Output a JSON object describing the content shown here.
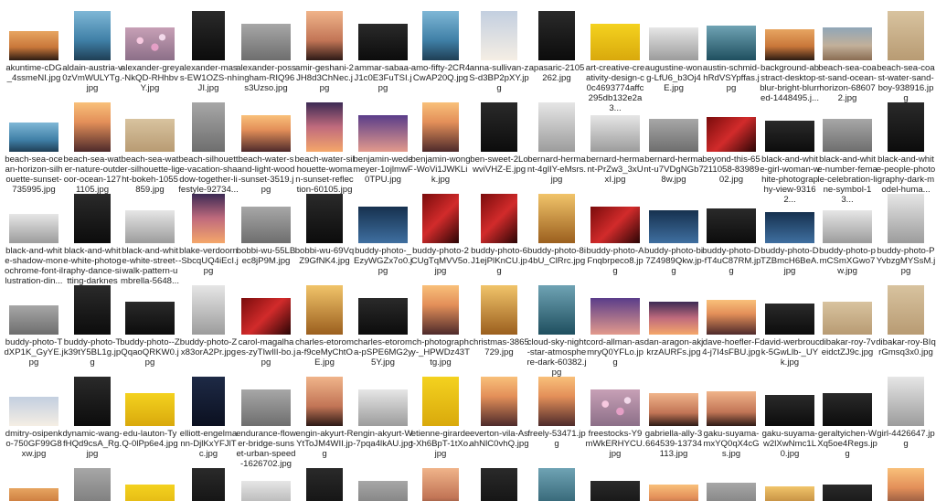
{
  "files": [
    {
      "name": "akuntime-cDG_4ssmeNI.jpg",
      "thumb": "t-sun1"
    },
    {
      "name": "aldain-austria-v0zVmWULYTg.jpg",
      "thumb": "t-lake"
    },
    {
      "name": "alexander-grey-NkQD-RHhbvY.jpg",
      "thumb": "t-bokeh"
    },
    {
      "name": "alexander-mass-EW1OZS-nhJI.jpg",
      "thumb": "t-dark"
    },
    {
      "name": "alexander-possingham-RIQ96s3Uzso.jpg",
      "thumb": "t-grey"
    },
    {
      "name": "amir-geshani-2JH8d3ChNec.jpg",
      "thumb": "t-warm"
    },
    {
      "name": "ammar-sabaa-J1c0E3FuTSI.jpg",
      "thumb": "t-dark"
    },
    {
      "name": "amo-fifty-2CR4CwAP20Q.jpg",
      "thumb": "t-lake"
    },
    {
      "name": "anna-sullivan-zS-d3BP2pXY.jpg",
      "thumb": "t-sky"
    },
    {
      "name": "apasaric-2105262.jpg",
      "thumb": "t-dark"
    },
    {
      "name": "art-creative-creativity-design-c0c4693774affc295db132e2a3...",
      "thumb": "t-yellow"
    },
    {
      "name": "augustine-wong-LfU6_b3Oj4E.jpg",
      "thumb": "t-mono"
    },
    {
      "name": "austin-schmid-hRdVSYpffas.jpg",
      "thumb": "t-teal"
    },
    {
      "name": "background-abstract-desktop-blur-bright-blurred-1448495.j...",
      "thumb": "t-sun1"
    },
    {
      "name": "beach-sea-coast-sand-ocean-horizon-686072.jpg",
      "thumb": "t-beach"
    },
    {
      "name": "beach-sea-coast-water-sand-boy-938916.jpg",
      "thumb": "t-sand"
    },
    {
      "name": "beach-sea-ocean-horizon-silhouette-sunset-735995.jpg",
      "thumb": "t-lake"
    },
    {
      "name": "beach-sea-water-nature-outdoor-ocean-1271105.jpg",
      "thumb": "t-sunset2"
    },
    {
      "name": "beach-sea-water-silhouette-light-bokeh-1055859.jpg",
      "thumb": "t-sand"
    },
    {
      "name": "beach-silhouette-vacation-shadow-together-lifestyle-92734...",
      "thumb": "t-grey"
    },
    {
      "name": "beach-water-sand-light-wood-sunset-3519.jpg",
      "thumb": "t-sunset2"
    },
    {
      "name": "beach-water-silhouette-woman-sunset-reflection-60105.jpg",
      "thumb": "t-pinksky"
    },
    {
      "name": "benjamin-wedemeyer-1ojlmwF0TPU.jpg",
      "thumb": "t-purple"
    },
    {
      "name": "benjamin-wong-WoVi1JWKLik.jpg",
      "thumb": "t-sunset2"
    },
    {
      "name": "ben-sweet-2LowviVHZ-E.jpg",
      "thumb": "t-dark"
    },
    {
      "name": "bernard-hermant-4gIlY-eMsrs.jpg",
      "thumb": "t-mono"
    },
    {
      "name": "bernard-hermant-PrZw3_3xUxI.jpg",
      "thumb": "t-mono"
    },
    {
      "name": "bernard-hermant-u7VDgNGb78w.jpg",
      "thumb": "t-grey"
    },
    {
      "name": "beyond-this-65211058-8398902.jpg",
      "thumb": "t-red"
    },
    {
      "name": "black-and-white-girl-woman-white-photography-view-93162...",
      "thumb": "t-dark"
    },
    {
      "name": "black-and-white-number-female-celebration-line-symbol-13...",
      "thumb": "t-grey"
    },
    {
      "name": "black-and-white-people-photography-dark-model-huma...",
      "thumb": "t-dark"
    },
    {
      "name": "black-and-white-shadow-monochrome-font-illustration-din...",
      "thumb": "t-mono"
    },
    {
      "name": "black-and-white-white-photography-dance-sitting-darkness...",
      "thumb": "t-dark"
    },
    {
      "name": "black-and-white-white-street-walk-pattern-umbrella-5648...",
      "thumb": "t-mono"
    },
    {
      "name": "blake-verdoorn-SbcqUQ4iEcI.jpg",
      "thumb": "t-pinksky"
    },
    {
      "name": "bobbi-wu-55LBec8jP9M.jpg",
      "thumb": "t-grey"
    },
    {
      "name": "bobbi-wu-69VqZ9GfNK4.jpg",
      "thumb": "t-dark"
    },
    {
      "name": "buddy-photo-_EzyWGZx7o0.jpg",
      "thumb": "t-blue"
    },
    {
      "name": "buddy-photo-2CUgTqMVV5o.jpg",
      "thumb": "t-red"
    },
    {
      "name": "buddy-photo-6J1ejPlKnCU.jpg",
      "thumb": "t-red"
    },
    {
      "name": "buddy-photo-8i4bU_ClRrc.jpg",
      "thumb": "t-gold"
    },
    {
      "name": "buddy-photo-AFnqbrpeco8.jpg",
      "thumb": "t-red"
    },
    {
      "name": "buddy-photo-bi7Z4989Qkw.jpg",
      "thumb": "t-blue"
    },
    {
      "name": "buddy-photo-D-fT4uC87RM.jpg",
      "thumb": "t-dark"
    },
    {
      "name": "buddy-photo-DTZBmcH6BeA.jpg",
      "thumb": "t-blue"
    },
    {
      "name": "buddy-photo-pmCSmXGwo7w.jpg",
      "thumb": "t-mono"
    },
    {
      "name": "buddy-photo-PYvbzgMYSsM.jpg",
      "thumb": "t-mono"
    },
    {
      "name": "buddy-photo-TdXP1K_GyYE.jpg",
      "thumb": "t-grey"
    },
    {
      "name": "buddy-photo-Tk39tY5BL1g.jpg",
      "thumb": "t-dark"
    },
    {
      "name": "buddy-photo--ZQqaoQRKW0.jpg",
      "thumb": "t-dark"
    },
    {
      "name": "buddy-photo-Zx83orA2Pr.jpg",
      "thumb": "t-mono"
    },
    {
      "name": "carol-magalhaes-zyTIwIlI-bo.jpg",
      "thumb": "t-red"
    },
    {
      "name": "charles-etoroma-f9ceMyChtOE.jpg",
      "thumb": "t-gold"
    },
    {
      "name": "charles-etoroma-pSPE6MG2y5Y.jpg",
      "thumb": "t-dark"
    },
    {
      "name": "ch-photography-_HPWDz43Ttg.jpg",
      "thumb": "t-sunset2"
    },
    {
      "name": "christmas-3865729.jpg",
      "thumb": "t-gold"
    },
    {
      "name": "cloud-sky-night-star-atmosphere-dark-60382.jpg",
      "thumb": "t-teal"
    },
    {
      "name": "cord-allman-asmryQ0YFLo.jpg",
      "thumb": "t-purple"
    },
    {
      "name": "dan-aragon-akjkrzAURFs.jpg",
      "thumb": "t-pinksky"
    },
    {
      "name": "dave-hoefler-F4-j7I4sFBU.jpg",
      "thumb": "t-sunset2"
    },
    {
      "name": "david-werbrouck-5GwLlb-_UYk.jpg",
      "thumb": "t-dark"
    },
    {
      "name": "dibakar-roy-7veidctZJ9c.jpg",
      "thumb": "t-sand"
    },
    {
      "name": "dibakar-roy-BIqrGmsq3x0.jpg",
      "thumb": "t-sand"
    },
    {
      "name": "dmitry-osipenko-750GF99G8xw.jpg",
      "thumb": "t-sky"
    },
    {
      "name": "dynamic-wang-fHQd9csA_Rg.jpg",
      "thumb": "t-dark"
    },
    {
      "name": "edu-lauton-TyQ-0lPp6e4.jpg",
      "thumb": "t-yellow"
    },
    {
      "name": "elliott-engelmann-DjlKxYFJlTc.jpg",
      "thumb": "t-night"
    },
    {
      "name": "endurance-flower-bridge-sunset-urban-speed-1626702.jpg",
      "thumb": "t-grey"
    },
    {
      "name": "engin-akyurt-RYtToJM4WII.jpg",
      "thumb": "t-warm"
    },
    {
      "name": "engin-akyurt-W-7pqa4lkAU.jpg",
      "thumb": "t-mono"
    },
    {
      "name": "etienne-girardet-Xh6BpT-1tXo.jpg",
      "thumb": "t-yellow"
    },
    {
      "name": "everton-vila-AsahNlC0vhQ.jpg",
      "thumb": "t-sunset2"
    },
    {
      "name": "freely-53471.jpg",
      "thumb": "t-sunset2"
    },
    {
      "name": "freestocks-Y9mWkERHYCU.jpg",
      "thumb": "t-bokeh"
    },
    {
      "name": "gabriella-ally-3664539-13734113.jpg",
      "thumb": "t-warm"
    },
    {
      "name": "gaku-suyama-mxYQ0qX4cGs.jpg",
      "thumb": "t-warm"
    },
    {
      "name": "gaku-suyama-w2lXwNmc1L0.jpg",
      "thumb": "t-dark"
    },
    {
      "name": "geraltyichen-WXq5oe4Regs.jpg",
      "thumb": "t-dark"
    },
    {
      "name": "girl-4426647.jpg",
      "thumb": "t-mono"
    },
    {
      "name": "",
      "thumb": "t-sun1"
    },
    {
      "name": "",
      "thumb": "t-grey"
    },
    {
      "name": "",
      "thumb": "t-yellow"
    },
    {
      "name": "",
      "thumb": "t-dark"
    },
    {
      "name": "",
      "thumb": "t-mono"
    },
    {
      "name": "",
      "thumb": "t-dark"
    },
    {
      "name": "",
      "thumb": "t-grey"
    },
    {
      "name": "",
      "thumb": "t-warm"
    },
    {
      "name": "",
      "thumb": "t-dark"
    },
    {
      "name": "",
      "thumb": "t-teal"
    },
    {
      "name": "",
      "thumb": "t-dark"
    },
    {
      "name": "",
      "thumb": "t-sunset2"
    },
    {
      "name": "",
      "thumb": "t-grey"
    },
    {
      "name": "",
      "thumb": "t-gold"
    },
    {
      "name": "",
      "thumb": "t-dark"
    },
    {
      "name": "",
      "thumb": "t-sunset2"
    }
  ]
}
